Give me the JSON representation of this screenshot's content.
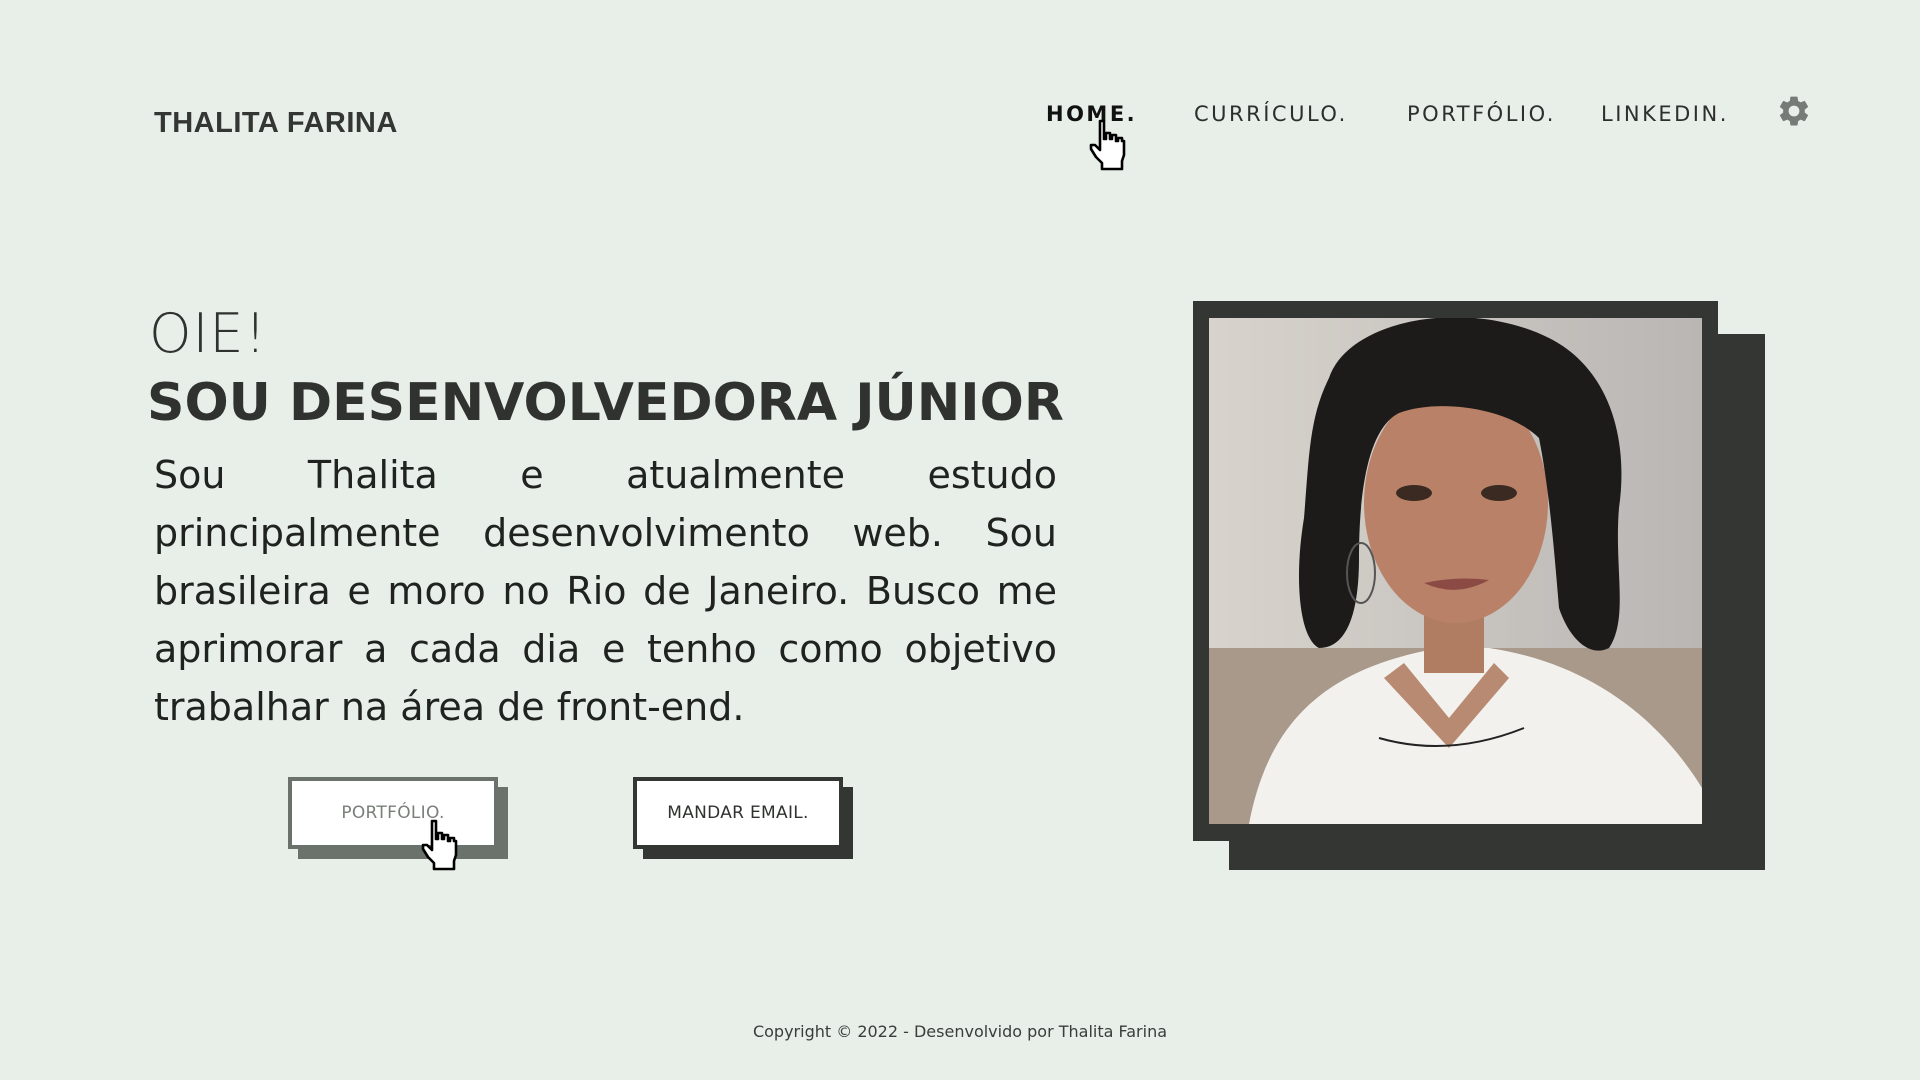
{
  "header": {
    "brand": "THALITA FARINA",
    "nav": [
      {
        "label": "HOME."
      },
      {
        "label": "CURRÍCULO."
      },
      {
        "label": "PORTFÓLIO."
      },
      {
        "label": "LINKEDIN."
      }
    ],
    "settings_icon": "gear-icon"
  },
  "hero": {
    "greeting": "OIE!",
    "title": "SOU DESENVOLVEDORA JÚNIOR",
    "description": "Sou Thalita e atualmente estudo principalmente desenvolvimento web. Sou brasileira e moro no Rio de Janeiro. Busco me aprimorar a cada dia e tenho como objetivo trabalhar na área de front-end.",
    "buttons": {
      "portfolio": "PORTFÓLIO.",
      "email": "MANDAR EMAIL."
    }
  },
  "footer": {
    "copyright": "Copyright © 2022 - Desenvolvido por Thalita Farina"
  },
  "colors": {
    "background": "#e8eee8",
    "dark": "#333633",
    "muted_button": "#6b716b"
  }
}
